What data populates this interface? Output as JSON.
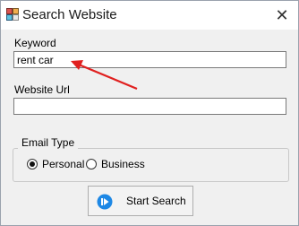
{
  "window": {
    "title": "Search Website",
    "close_symbol": "✕"
  },
  "form": {
    "keyword_label": "Keyword",
    "keyword_value": "rent car",
    "url_label": "Website Url",
    "url_value": "",
    "email_type_label": "Email Type",
    "email_type_options": [
      {
        "label": "Personal",
        "checked": true
      },
      {
        "label": "Business",
        "checked": false
      }
    ],
    "search_button_label": "Start Search"
  },
  "icons": {
    "app": "app-window-icon",
    "close": "close-icon",
    "search_button": "play-circle-icon",
    "annotation": "red-arrow-annotation"
  },
  "colors": {
    "accent_blue": "#1e88e5",
    "annotation_red": "#e0201f"
  }
}
